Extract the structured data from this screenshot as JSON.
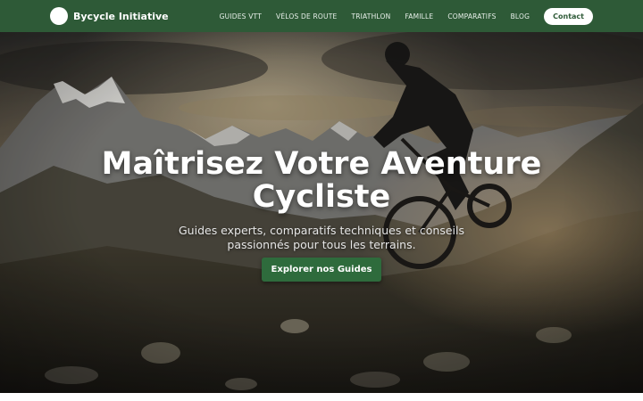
{
  "brand": {
    "name": "Bycycle Initiative"
  },
  "nav": {
    "links": [
      "GUIDES VTT",
      "VÉLOS DE ROUTE",
      "TRIATHLON",
      "FAMILLE",
      "COMPARATIFS",
      "BLOG"
    ],
    "contact_label": "Contact"
  },
  "hero": {
    "title": "Maîtrisez Votre Aventure Cycliste",
    "subtitle": "Guides experts, comparatifs techniques et conseils passionnés pour tous les terrains.",
    "cta_label": "Explorer nos Guides"
  },
  "colors": {
    "navbar": "#2e5a37",
    "cta": "#2e6b3c",
    "page_bg": "#ffffff"
  }
}
